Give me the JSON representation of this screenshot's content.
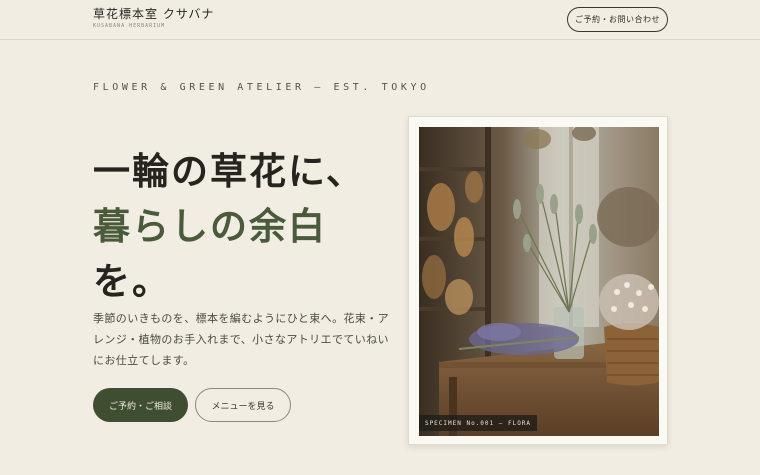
{
  "brand": {
    "name": "草花標本室 クサバナ",
    "subtitle": "KUSABANA HERBARIUM"
  },
  "header": {
    "contact_label": "ご予約・お問い合わせ"
  },
  "hero": {
    "eyebrow": "FLOWER & GREEN ATELIER — EST. TOKYO",
    "headline": [
      "一輪の草花に、",
      "暮らしの余白",
      "を。"
    ],
    "lead": [
      "季節のいきものを、標本を編むようにひと束へ。花束・ア",
      "レンジ・植物のお手入れまで、小さなアトリエでていねい",
      "にお仕立てします。"
    ],
    "primary_label": "ご予約・ご相談",
    "secondary_label": "メニューを見る"
  },
  "photo": {
    "caption": "SPECIMEN No.001 — FLORA"
  },
  "colors": {
    "background": "#f1ede2",
    "accent_green": "#3f4d30",
    "headline_accent": "#4a5a3b",
    "text": "#25241f"
  }
}
